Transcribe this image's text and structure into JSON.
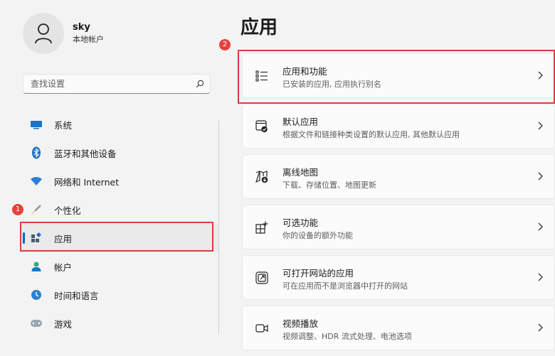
{
  "account": {
    "name": "sky",
    "type": "本地帐户"
  },
  "search": {
    "placeholder": "查找设置"
  },
  "nav": {
    "items": [
      {
        "label": "系统",
        "icon": "system-icon"
      },
      {
        "label": "蓝牙和其他设备",
        "icon": "bluetooth-icon"
      },
      {
        "label": "网络和 Internet",
        "icon": "wifi-icon"
      },
      {
        "label": "个性化",
        "icon": "brush-icon"
      },
      {
        "label": "应用",
        "icon": "apps-icon",
        "selected": true
      },
      {
        "label": "帐户",
        "icon": "person-icon"
      },
      {
        "label": "时间和语言",
        "icon": "globe-clock-icon"
      },
      {
        "label": "游戏",
        "icon": "gamepad-icon"
      }
    ]
  },
  "page": {
    "title": "应用"
  },
  "cards": [
    {
      "title": "应用和功能",
      "subtitle": "已安装的应用, 应用执行别名",
      "icon": "list-icon"
    },
    {
      "title": "默认应用",
      "subtitle": "根据文件和链接种类设置的默认应用, 其他默认应用",
      "icon": "default-app-icon"
    },
    {
      "title": "离线地图",
      "subtitle": "下载、存储位置、地图更新",
      "icon": "map-download-icon"
    },
    {
      "title": "可选功能",
      "subtitle": "你的设备的额外功能",
      "icon": "grid-add-icon"
    },
    {
      "title": "可打开网站的应用",
      "subtitle": "可在应用而不是浏览器中打开的网站",
      "icon": "open-link-icon"
    },
    {
      "title": "视频播放",
      "subtitle": "视频调整、HDR 流式处理、电池选项",
      "icon": "video-icon"
    }
  ],
  "annotations": {
    "badge_1": "1",
    "badge_2": "2"
  },
  "colors": {
    "accent": "#0067c0",
    "highlight": "#e03a3e",
    "badge": "#e8413c"
  }
}
